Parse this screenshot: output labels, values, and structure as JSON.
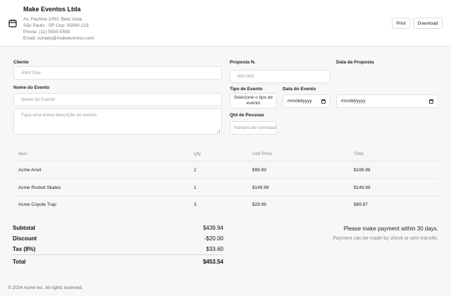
{
  "header": {
    "company": "Make Eventos Ltda",
    "address_lines": [
      "Av. Paulista 1000, Bela Vista,",
      "São Paulo - SP Cep: 05000-123",
      "Phone: (11) 5555-5555",
      "Email: contato@makeeventos.com"
    ],
    "print_label": "Print",
    "download_label": "Download"
  },
  "form": {
    "cliente_label": "Cliente",
    "cliente_placeholder": "John Doe",
    "nome_evento_label": "Nome do Evento",
    "nome_evento_placeholder": "Nome do Evento",
    "descricao_placeholder": "Faça uma breve descrição do evento",
    "proposta_label": "Proposta N.",
    "proposta_placeholder": "INV-001",
    "data_proposta_label": "Data da Proposta",
    "data_proposta_value": "mm/dd/yyyy",
    "tipo_evento_label": "Tipo de Evento",
    "tipo_evento_value": "Selecione o tipo de evento",
    "data_evento_label": "Data do Evento",
    "data_evento_value": "mm/dd/yyyy",
    "qtd_pessoas_label": "Qtd de Pessoas",
    "qtd_pessoas_placeholder": "Número de convidados"
  },
  "table": {
    "headers": [
      "Item",
      "Qty",
      "Unit Price",
      "Total"
    ],
    "rows": [
      [
        "Acme Anvil",
        "2",
        "$99.99",
        "$199.98"
      ],
      [
        "Acme Rocket Skates",
        "1",
        "$149.99",
        "$149.99"
      ],
      [
        "Acme Coyote Trap",
        "3",
        "$29.99",
        "$89.97"
      ]
    ]
  },
  "summary": {
    "subtotal_label": "Subtotal",
    "subtotal": "$439.94",
    "discount_label": "Discount",
    "discount": "-$20.00",
    "tax_label": "Tax (8%)",
    "tax": "$33.60",
    "total_label": "Total",
    "total": "$453.54",
    "payment_note": "Please make payment within 30 days.",
    "payment_methods": "Payment can be made by check or wire transfer."
  },
  "footer": {
    "copyright": "© 2024 Acme Inc. All rights reserved."
  }
}
